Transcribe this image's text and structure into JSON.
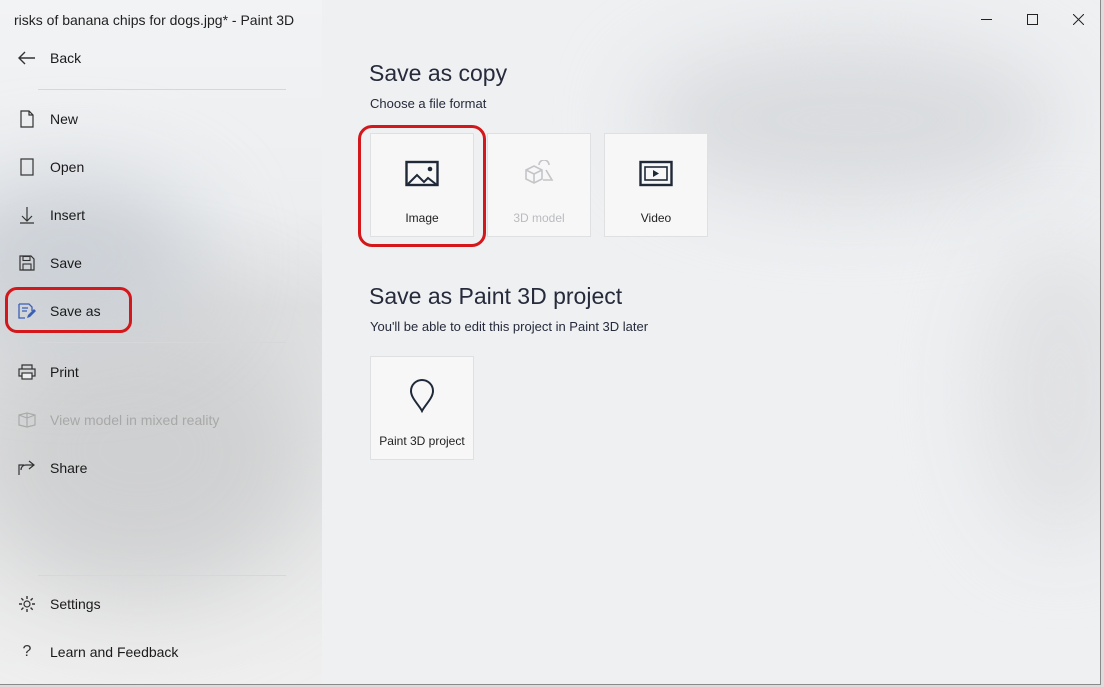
{
  "window": {
    "title": "risks of banana chips for dogs.jpg* - Paint 3D"
  },
  "sidebar": {
    "back_label": "Back",
    "items": [
      {
        "id": "new",
        "label": "New",
        "icon": "document-icon"
      },
      {
        "id": "open",
        "label": "Open",
        "icon": "folder-open-icon"
      },
      {
        "id": "insert",
        "label": "Insert",
        "icon": "insert-arrow-icon"
      },
      {
        "id": "save",
        "label": "Save",
        "icon": "floppy-disk-icon"
      },
      {
        "id": "save_as",
        "label": "Save as",
        "icon": "save-as-icon",
        "selected": true
      },
      {
        "id": "print",
        "label": "Print",
        "icon": "printer-icon"
      },
      {
        "id": "mixed_reality",
        "label": "View model in mixed reality",
        "icon": "mixed-reality-icon",
        "disabled": true
      },
      {
        "id": "share",
        "label": "Share",
        "icon": "share-icon"
      }
    ],
    "footer": [
      {
        "id": "settings",
        "label": "Settings",
        "icon": "gear-icon"
      },
      {
        "id": "feedback",
        "label": "Learn and Feedback",
        "icon": "question-icon"
      }
    ]
  },
  "main": {
    "save_copy": {
      "heading": "Save as copy",
      "subheading": "Choose a file format",
      "formats": [
        {
          "label": "Image",
          "icon": "image-icon"
        },
        {
          "label": "3D model",
          "icon": "3d-shapes-icon",
          "disabled": true
        },
        {
          "label": "Video",
          "icon": "video-icon"
        }
      ]
    },
    "project": {
      "heading": "Save as Paint 3D project",
      "subheading": "You'll be able to edit this project in Paint 3D later",
      "option_label": "Paint 3D project",
      "option_icon": "paint-3d-drop-icon"
    }
  },
  "colors": {
    "annotation": "#d3171b",
    "accent_icon": "#3a5fb4",
    "heading": "#262a3a"
  }
}
